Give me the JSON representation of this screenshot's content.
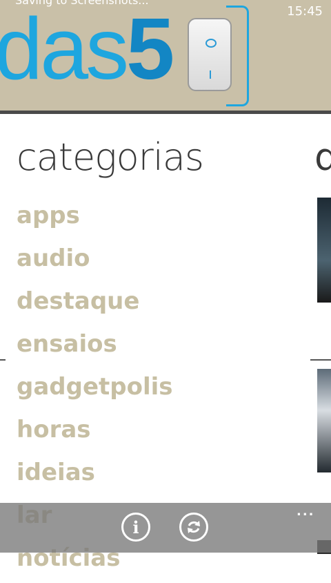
{
  "status": {
    "message": "Saving to Screenshots...",
    "time": "15:45"
  },
  "logo": {
    "part_a": "das",
    "part_b": "5"
  },
  "section": {
    "title": "categorias",
    "next_title": "d"
  },
  "categories": [
    "apps",
    "audio",
    "destaque",
    "ensaios",
    "gadgetpolis",
    "horas",
    "ideias",
    "lar",
    "notícias"
  ],
  "appbar": {
    "more": "..."
  },
  "icons": {
    "info": "info-icon",
    "refresh": "refresh-icon",
    "more": "more-icon"
  },
  "colors": {
    "header": "#c9c0a8",
    "logo_blue": "#1ea6df",
    "category": "#c7bfa3",
    "title": "#3a3a3a"
  }
}
